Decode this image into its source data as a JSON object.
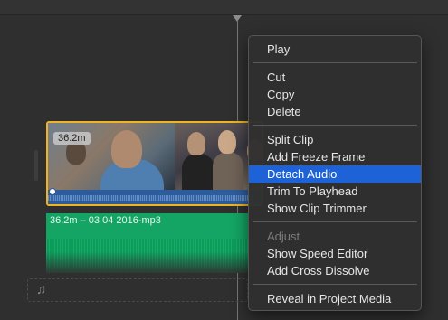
{
  "clip": {
    "duration_badge": "36.2m"
  },
  "audio_clip": {
    "label": "36.2m – 03 04 2016-mp3"
  },
  "music_well": {
    "icon": "music-note-icon",
    "glyph": "♫"
  },
  "menu": {
    "highlight_color": "#1d62d6",
    "items": [
      {
        "label": "Play",
        "enabled": true
      },
      {
        "label": "Cut",
        "enabled": true
      },
      {
        "label": "Copy",
        "enabled": true
      },
      {
        "label": "Delete",
        "enabled": true
      },
      {
        "label": "Split Clip",
        "enabled": true
      },
      {
        "label": "Add Freeze Frame",
        "enabled": true
      },
      {
        "label": "Detach Audio",
        "enabled": true,
        "highlighted": true
      },
      {
        "label": "Trim To Playhead",
        "enabled": true
      },
      {
        "label": "Show Clip Trimmer",
        "enabled": true
      },
      {
        "label": "Adjust",
        "enabled": false
      },
      {
        "label": "Show Speed Editor",
        "enabled": true
      },
      {
        "label": "Add Cross Dissolve",
        "enabled": true
      },
      {
        "label": "Reveal in Project Media",
        "enabled": true
      }
    ]
  },
  "colors": {
    "clip_border": "#f0b323",
    "audio_track": "#14a564",
    "clip_audio": "#2d5c9c"
  }
}
